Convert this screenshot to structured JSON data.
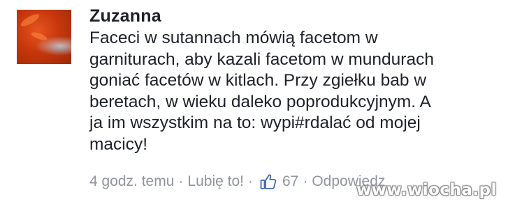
{
  "comment": {
    "author": "Zuzanna",
    "text": "Faceci w sutannach mówią facetom w\ngarniturach, aby kazali facetom w mundurach\ngoniać facetów w kitlach. Przy zgiełku bab w\nberetach, w wieku daleko poprodukcyjnym. A\nja im wszystkim na to: wypi#rdalać od mojej\nmacicy!",
    "timestamp": "4 godz. temu",
    "like_label": "Lubię to!",
    "like_icon": "thumbs-up-icon",
    "like_count": "67",
    "reply_label": "Odpowiedz",
    "separator": "·"
  },
  "watermark": "www.wiocha.pl",
  "colors": {
    "text": "#1d2129",
    "meta": "#90949c",
    "like_blue": "#4267b2"
  }
}
